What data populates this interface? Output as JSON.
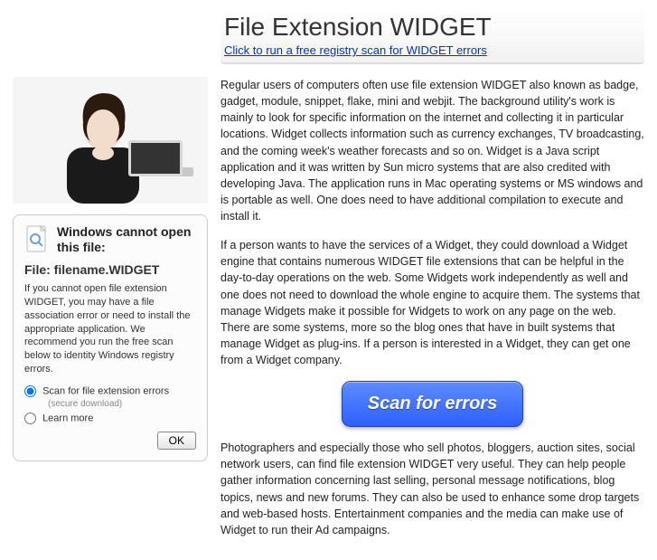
{
  "header": {
    "title": "File Extension WIDGET",
    "link": "Click to run a free registry scan for WIDGET errors"
  },
  "sidebox": {
    "warn_title": "Windows cannot open this file:",
    "file_label": "File: filename.WIDGET",
    "desc": "If you cannot open file extension WIDGET, you may have a file association error or need to install the appropriate application. We recommend you run the free scan below to identity Windows registry errors.",
    "opt_scan": "Scan for file extension errors",
    "opt_scan_note": "(secure download)",
    "opt_learn": "Learn more",
    "ok_label": "OK"
  },
  "main": {
    "p1": "Regular users of computers often use file extension WIDGET also known as badge, gadget, module, snippet, flake, mini and webjit. The background utility's work is mainly to look for specific information on the internet and collecting it in particular locations. Widget collects information such as currency exchanges, TV broadcasting, and the coming week's weather forecasts and so on. Widget is a Java script application and it was written by Sun micro systems that are also credited with developing Java. The application runs in Mac operating systems or MS windows and is portable as well. One does need to have additional compilation to execute and install it.",
    "p2": "If a person wants to have the services of a Widget, they could download a Widget engine that contains numerous WIDGET file extensions that can be helpful in the day-to-day operations on the web. Some Widgets work independently as well and one does not need to download the whole engine to acquire them. The systems that manage Widgets make it possible for Widgets to work on any page on the web. There are some systems, more so the blog ones that have in built systems that manage Widget as plug-ins. If a person is interested in a Widget, they can get one from a Widget company.",
    "scan_btn": "Scan for errors",
    "p3": "Photographers and especially those who sell photos, bloggers, auction sites, social network users, can find file extension WIDGET very useful. They can help people gather information concerning last selling, personal message notifications, blog topics, news and new forums. They can also be used to enhance some drop targets and web-based hosts. Entertainment companies and the media can make use of Widget to run their Ad campaigns."
  }
}
